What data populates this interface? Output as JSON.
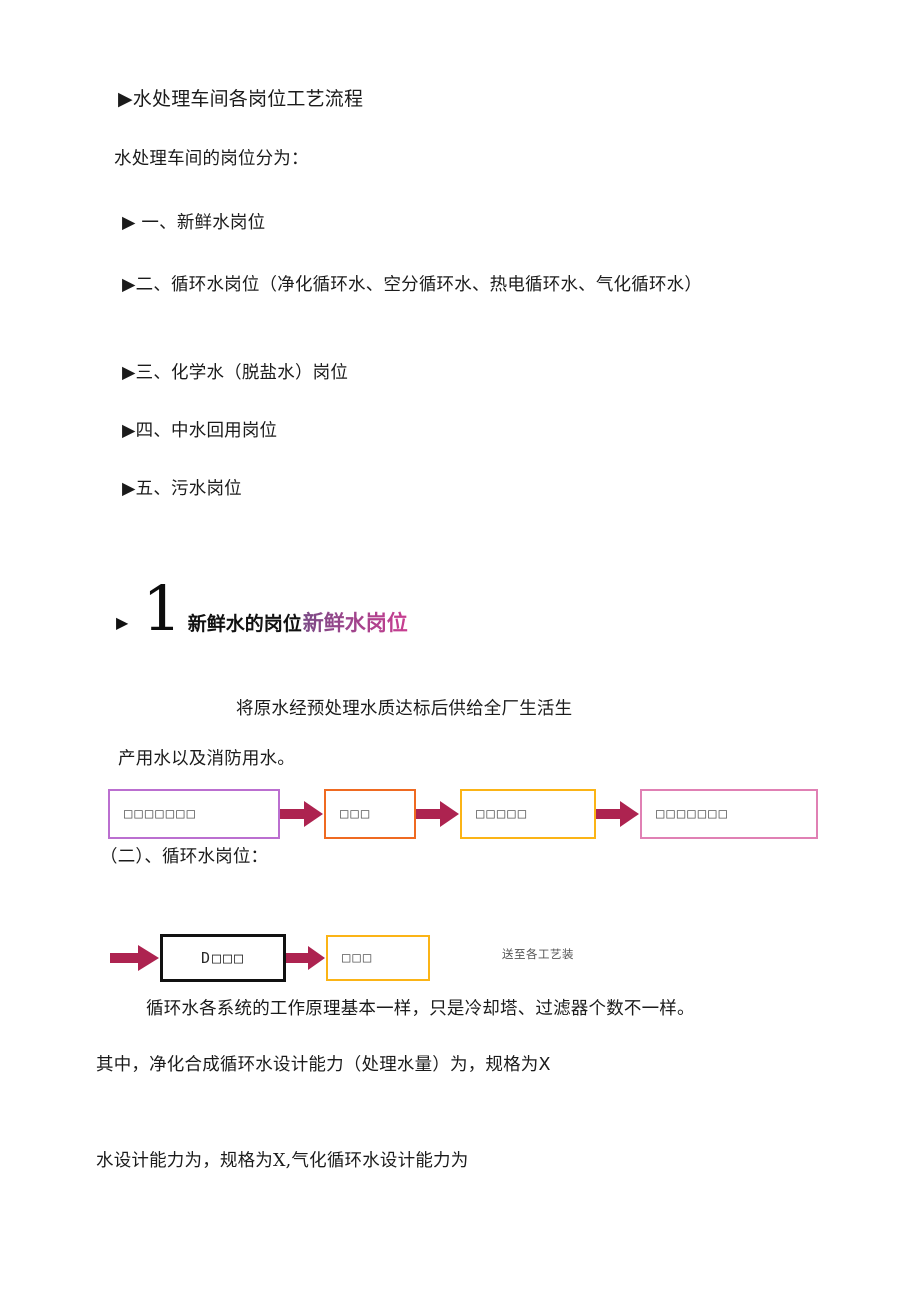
{
  "document": {
    "title": "水处理车间各岗位工艺流程"
  },
  "sections": {
    "heading": "▶水处理车间各岗位工艺流程",
    "intro": "水处理车间的岗位分为：",
    "post_list": [
      "▶ 一、新鲜水岗位",
      "▶二、循环水岗位（净化循环水、空分循环水、热电循环水、气化循环水）",
      "▶三、化学水（脱盐水）岗位",
      "▶四、中水回用岗位",
      "▶五、污水岗位"
    ]
  },
  "section_one": {
    "bullet": "▶",
    "number": "1",
    "label_black": "新鲜水的岗位",
    "label_colored": "新鲜水岗位",
    "accent_start": "#7a4a86",
    "accent_end": "#c93d91",
    "description_line1": "将原水经预处理水质达标后供给全厂生活生",
    "description_line2": "产用水以及消防用水。"
  },
  "flow_fresh_water": {
    "boxes": [
      {
        "label": "□□□□□□□",
        "border": "#bb6fd0"
      },
      {
        "label": "□□□",
        "border": "#ef6a21"
      },
      {
        "label": "□□□□□",
        "border": "#fbb416"
      },
      {
        "label": "□□□□□□□",
        "border": "#e080b4"
      }
    ],
    "arrow_color": "#ad2350"
  },
  "section_two": {
    "heading": "（二）、循环水岗位："
  },
  "flow_circulating_water": {
    "boxes": [
      {
        "label": "D□□□",
        "border": "#111111"
      },
      {
        "label": "□□□",
        "border": "#fbb416"
      }
    ],
    "tail_label": "送至各工艺装",
    "arrow_color": "#ad2350"
  },
  "closing": {
    "note": "循环水各系统的工作原理基本一样，只是冷却塔、过滤器个数不一样。",
    "spec_line_1": "其中，净化合成循环水设计能力（处理水量）为，规格为X",
    "spec_line_2": "水设计能力为，规格为X,气化循环水设计能力为"
  }
}
